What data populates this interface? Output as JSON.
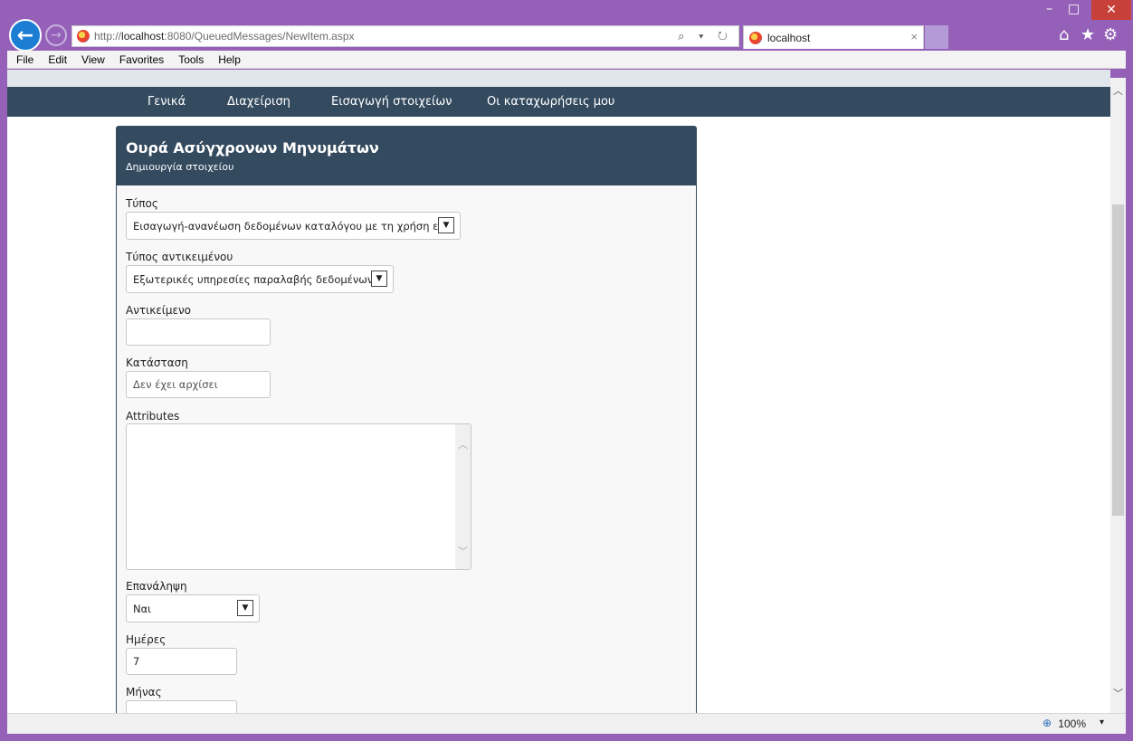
{
  "browser": {
    "url_prefix": "http://",
    "url_host": "localhost",
    "url_rest": ":8080/QueuedMessages/NewItem.aspx",
    "tab_title": "localhost",
    "tab_close": "×",
    "addr_icons": "⌕ ▾ ↻",
    "zoom": "100%",
    "zoom_dd": "▾"
  },
  "menu": [
    "File",
    "Edit",
    "View",
    "Favorites",
    "Tools",
    "Help"
  ],
  "site_nav": [
    "Γενικά",
    "Διαχείριση",
    "Εισαγωγή στοιχείων",
    "Οι καταχωρήσεις μου"
  ],
  "panel": {
    "title": "Ουρά Ασύγχρονων Μηνυμάτων",
    "subtitle": "Δημιουργία στοιχείου"
  },
  "form": {
    "type_label": "Τύπος",
    "type_value": "Εισαγωγή-ανανέωση δεδομένων καταλόγου με τη χρήση ε",
    "object_type_label": "Τύπος αντικειμένου",
    "object_type_value": "Εξωτερικές υπηρεσίες παραλαβής δεδομένων",
    "object_label": "Αντικείμενο",
    "object_value": "",
    "status_label": "Κατάσταση",
    "status_placeholder": "Δεν έχει αρχίσει",
    "attributes_label": "Attributes",
    "attributes_value": "",
    "repeat_label": "Επανάληψη",
    "repeat_value": "Ναι",
    "days_label": "Ημέρες",
    "days_value": "7",
    "month_label": "Μήνας",
    "month_value": ""
  }
}
